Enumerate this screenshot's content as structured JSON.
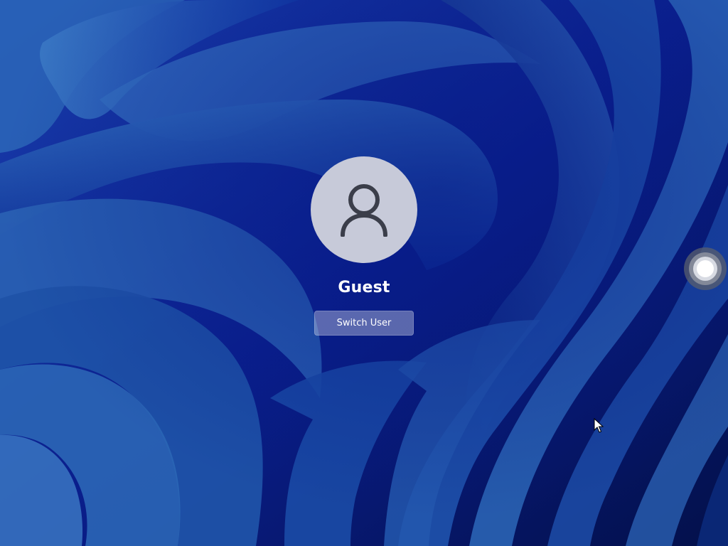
{
  "screen": {
    "type": "lock-screen-user-selection",
    "wallpaper": "blue-bloom-ribbons"
  },
  "user": {
    "avatar_icon": "person-icon",
    "name": "Guest"
  },
  "actions": {
    "switch_user_label": "Switch User"
  },
  "overlays": {
    "touch_indicator_icon": "touch-ripple-icon",
    "cursor_icon": "arrow-cursor-icon"
  },
  "colors": {
    "background": "#0b1f8a",
    "avatar_bg": "#c7cad9",
    "avatar_icon": "#3b3e4a",
    "text": "#ffffff"
  }
}
